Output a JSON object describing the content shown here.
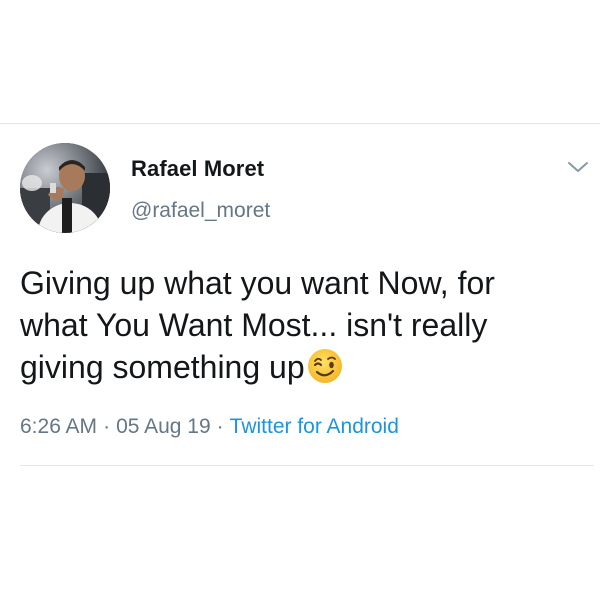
{
  "tweet": {
    "author": {
      "display_name": "Rafael Moret",
      "handle": "@rafael_moret"
    },
    "text_lines": [
      "Giving up what you want Now, for",
      "what You Want Most... isn't really",
      "giving something up"
    ],
    "emoji": "winking-face-emoji",
    "time": "6:26 AM",
    "date": "05 Aug 19",
    "separator": "·",
    "source": "Twitter for Android"
  },
  "icons": {
    "menu": "chevron-down-icon"
  },
  "colors": {
    "text_primary": "#14171a",
    "text_secondary": "#657786",
    "link": "#1b95e0",
    "divider": "#e1e8ed"
  }
}
